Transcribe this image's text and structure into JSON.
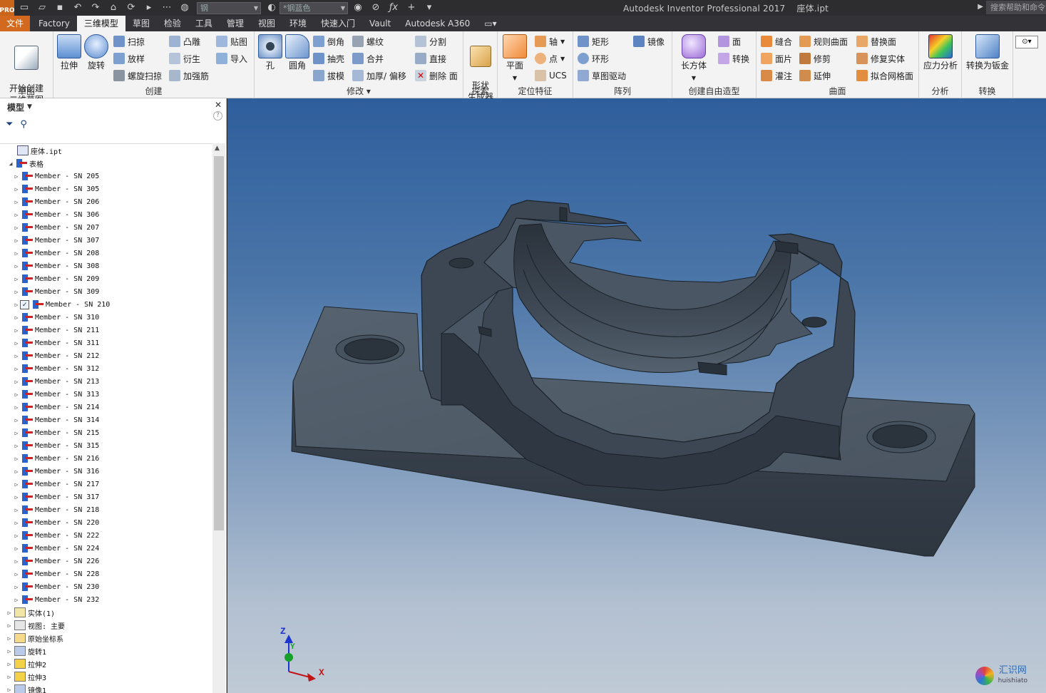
{
  "titlebar": {
    "logo": "PRO",
    "material": "钢",
    "appearance": "*钢蓝色",
    "app_title": "Autodesk Inventor Professional 2017",
    "file_name": "座体.ipt",
    "help_search": "搜索帮助和命令"
  },
  "tabs": [
    "文件",
    "Factory",
    "三维模型",
    "草图",
    "检验",
    "工具",
    "管理",
    "视图",
    "环境",
    "快速入门",
    "Vault",
    "Autodesk A360"
  ],
  "active_tab": "三维模型",
  "ribbon": {
    "sketch": {
      "title": "草图",
      "start_2d_sketch": "开始创建\n二维草图"
    },
    "create": {
      "title": "创建",
      "extrude": "拉伸",
      "revolve": "旋转",
      "sweep": "扫掠",
      "loft": "放样",
      "coil": "螺旋扫掠",
      "emboss": "凸雕",
      "derive": "衍生",
      "rib": "加强筋",
      "decal": "贴图",
      "import": "导入"
    },
    "modify": {
      "title": "修改",
      "hole": "孔",
      "fillet": "圆角",
      "chamfer": "倒角",
      "shell": "抽壳",
      "draft": "拔模",
      "thread": "螺纹",
      "combine": "合并",
      "thicken": "加厚/ 偏移",
      "split": "分割",
      "direct": "直接",
      "delete_face": "删除 面"
    },
    "explore": {
      "title": "探索",
      "shape_generator": "形状\n生成器"
    },
    "work_features": {
      "title": "定位特征",
      "plane": "平面",
      "axis": "轴",
      "point": "点",
      "ucs": "UCS"
    },
    "pattern": {
      "title": "阵列",
      "rectangular": "矩形",
      "circular": "环形",
      "sketch_driven": "草图驱动",
      "mirror": "镜像"
    },
    "freeform": {
      "title": "创建自由造型",
      "box": "长方体",
      "face": "面",
      "convert": "转换"
    },
    "surface": {
      "title": "曲面",
      "stitch": "缝合",
      "patch": "面片",
      "sculpt": "灌注",
      "ruled": "规则曲面",
      "trim": "修剪",
      "extend": "延伸",
      "replace_face": "替换面",
      "repair": "修复实体",
      "fit_mesh": "拟合网格面"
    },
    "analysis": {
      "title": "分析",
      "stress": "应力分析"
    },
    "convert": {
      "title": "转换",
      "sheet_metal": "转换为钣金"
    }
  },
  "browser": {
    "title": "模型",
    "root": "座体.ipt",
    "table_node": "表格",
    "members": [
      "Member - SN 205",
      "Member - SN 305",
      "Member - SN 206",
      "Member - SN 306",
      "Member - SN 207",
      "Member - SN 307",
      "Member - SN 208",
      "Member - SN 308",
      "Member - SN 209",
      "Member - SN 309",
      "Member - SN 210",
      "Member - SN 310",
      "Member - SN 211",
      "Member - SN 311",
      "Member - SN 212",
      "Member - SN 312",
      "Member - SN 213",
      "Member - SN 313",
      "Member - SN 214",
      "Member - SN 314",
      "Member - SN 215",
      "Member - SN 315",
      "Member - SN 216",
      "Member - SN 316",
      "Member - SN 217",
      "Member - SN 317",
      "Member - SN 218",
      "Member - SN 220",
      "Member - SN 222",
      "Member - SN 224",
      "Member - SN 226",
      "Member - SN 228",
      "Member - SN 230",
      "Member - SN 232"
    ],
    "checked_member": "Member - SN 210",
    "nodes": [
      "实体(1)",
      "视图: 主要",
      "原始坐标系",
      "旋转1",
      "拉伸2",
      "拉伸3",
      "镜像1"
    ]
  },
  "viewport": {
    "triad": {
      "z": "Z",
      "y": "Y",
      "x": "X"
    },
    "watermark": {
      "cn": "汇识网",
      "en": "huishiato"
    }
  },
  "colors": {
    "file_tab": "#d2691e",
    "part": "#3e4955",
    "bg_top": "#2e5e9c",
    "bg_bottom": "#c0cad6"
  }
}
